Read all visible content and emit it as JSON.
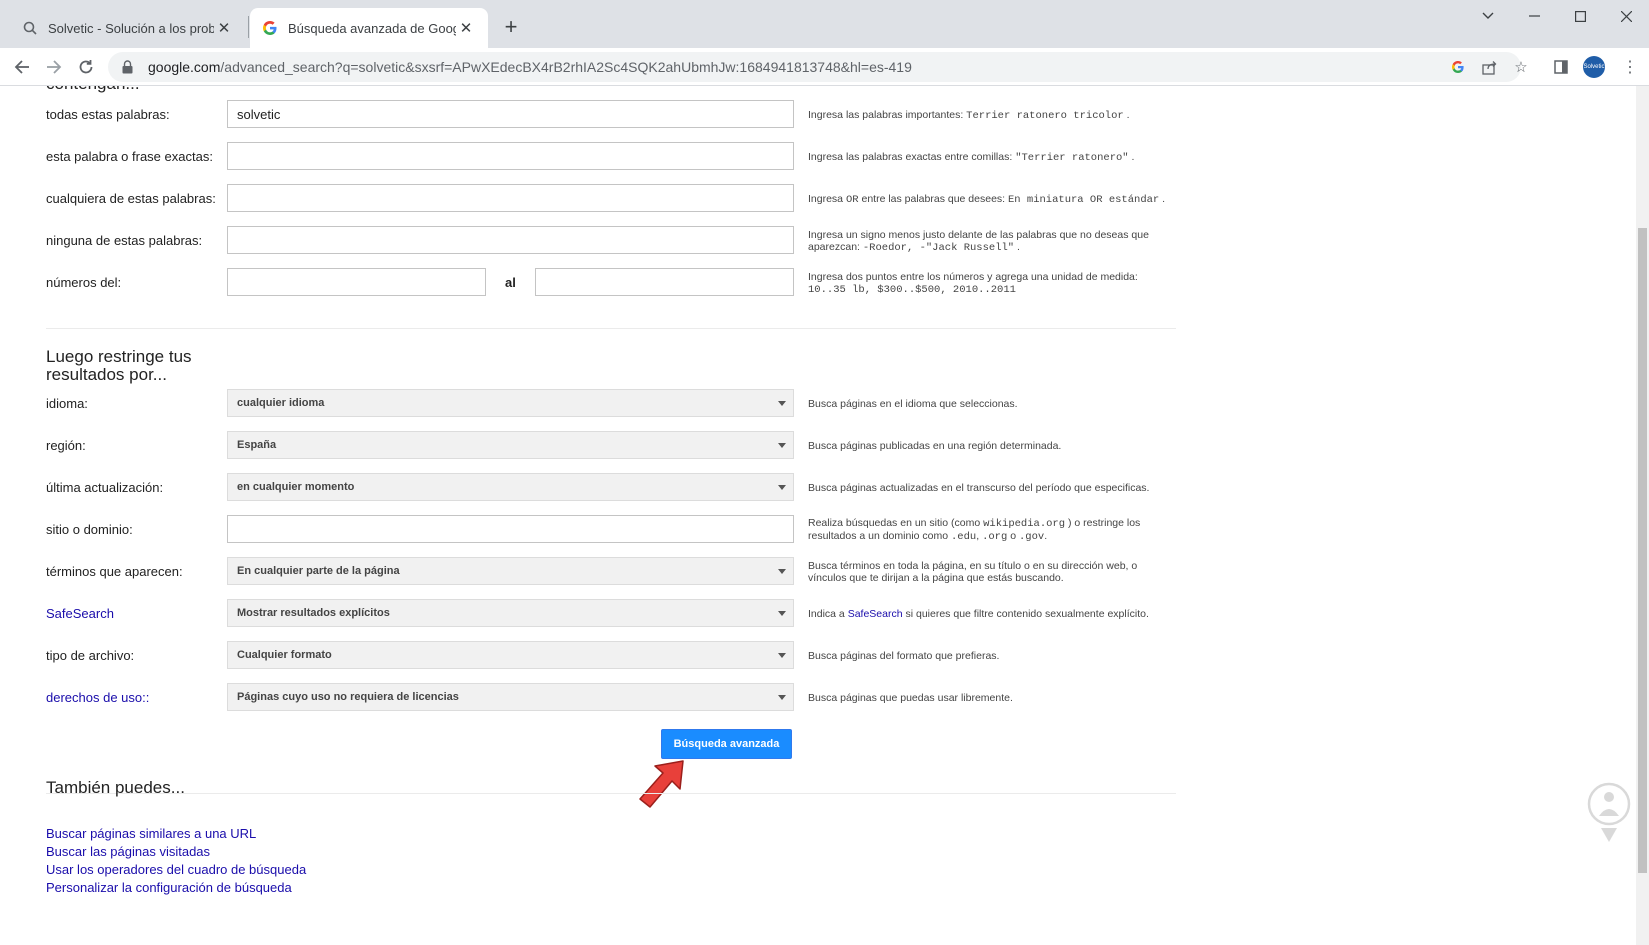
{
  "browser": {
    "tabs": [
      {
        "title": "Solvetic - Solución a los problem",
        "active": false
      },
      {
        "title": "Búsqueda avanzada de Google",
        "active": true
      }
    ],
    "url_host": "google.com",
    "url_rest": "/advanced_search?q=solvetic&sxsrf=APwXEdecBX4rB2rhIA2Sc4SQK2ahUbmhJw:1684941813748&hl=es-419",
    "profile_label": "Solvetic"
  },
  "top_fields": {
    "heading_partial": "contengan...",
    "all_words": {
      "label": "todas estas palabras:",
      "value": "solvetic",
      "hint_text": "Ingresa las palabras importantes: ",
      "hint_code": "Terrier ratonero tricolor",
      "hint_end": " ."
    },
    "exact_phrase": {
      "label": "esta palabra o frase exactas:",
      "value": "",
      "hint_text": "Ingresa las palabras exactas entre comillas: ",
      "hint_code": "\"Terrier ratonero\"",
      "hint_end": " ."
    },
    "any_words": {
      "label": "cualquiera de estas palabras:",
      "value": "",
      "hint_a": "Ingresa ",
      "hint_code1": "OR",
      "hint_b": " entre las palabras que desees: ",
      "hint_code2": "En miniatura OR estándar",
      "hint_end": " ."
    },
    "none_words": {
      "label": "ninguna de estas palabras:",
      "value": "",
      "hint_text": "Ingresa un signo menos justo delante de las palabras que no deseas que aparezcan: ",
      "hint_code": "-Roedor, -\"Jack Russell\"",
      "hint_end": " ."
    },
    "numbers": {
      "label": "números del:",
      "to_label": "al",
      "from_value": "",
      "to_value": "",
      "hint_text": "Ingresa dos puntos entre los números y agrega una unidad de medida: ",
      "hint_code": "10..35 lb, $300..$500, 2010..2011"
    }
  },
  "restrict": {
    "title_line1": "Luego restringe tus",
    "title_line2": "resultados por...",
    "language": {
      "label": "idioma:",
      "value": "cualquier idioma",
      "hint": "Busca páginas en el idioma que seleccionas."
    },
    "region": {
      "label": "región:",
      "value": "España",
      "hint": "Busca páginas publicadas en una región determinada."
    },
    "last_update": {
      "label": "última actualización:",
      "value": "en cualquier momento",
      "hint": "Busca páginas actualizadas en el transcurso del período que especificas."
    },
    "site": {
      "label": "sitio o dominio:",
      "value": "",
      "hint_a": "Realiza búsquedas en un sitio (como ",
      "hint_code1": "wikipedia.org",
      "hint_b": " ) o restringe los resultados a un dominio como ",
      "hint_code2": ".edu",
      "hint_c": ", ",
      "hint_code3": ".org",
      "hint_d": " o ",
      "hint_code4": ".gov",
      "hint_end": "."
    },
    "terms_appear": {
      "label": "términos que aparecen:",
      "value": "En cualquier parte de la página",
      "hint": "Busca términos en toda la página, en su título o en su dirección web, o vínculos que te dirijan a la página que estás buscando."
    },
    "safesearch": {
      "label": "SafeSearch",
      "value": "Mostrar resultados explícitos",
      "hint_a": "Indica a ",
      "hint_link": "SafeSearch",
      "hint_b": " si quieres que filtre contenido sexualmente explícito."
    },
    "file_type": {
      "label": "tipo de archivo:",
      "value": "Cualquier formato",
      "hint": "Busca páginas del formato que prefieras."
    },
    "usage_rights": {
      "label": "derechos de uso:",
      "label_suffix": ":",
      "value": "Páginas cuyo uso no requiera de licencias",
      "hint": "Busca páginas que puedas usar libremente."
    }
  },
  "submit_label": "Búsqueda avanzada",
  "also": {
    "title": "También puedes...",
    "links": [
      "Buscar páginas similares a una URL",
      "Buscar las páginas visitadas",
      "Usar los operadores del cuadro de búsqueda",
      "Personalizar la configuración de búsqueda"
    ]
  },
  "colors": {
    "link": "#1a0dab",
    "button": "#1a8cff",
    "pointer_arrow": "#e8403a"
  }
}
